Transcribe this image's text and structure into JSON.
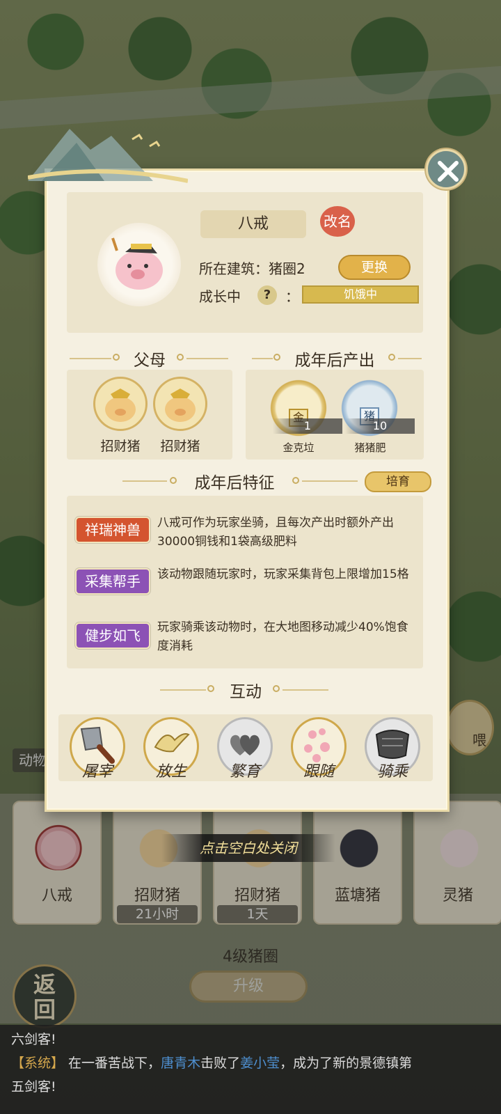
{
  "pet": {
    "name": "八戒",
    "rename_label": "改名",
    "location_label": "所在建筑：猪圈2",
    "change_label": "更换",
    "growth_label": "成长中",
    "help_symbol": "?",
    "colon": "：",
    "status": "饥饿中"
  },
  "sections": {
    "parents": "父母",
    "output": "成年后产出",
    "traits": "成年后特征",
    "interact": "互动"
  },
  "parents": [
    {
      "name": "招财猪"
    },
    {
      "name": "招财猪"
    }
  ],
  "outputs": [
    {
      "name": "金克垃",
      "icon_char": "金",
      "count": "1"
    },
    {
      "name": "猪猪肥",
      "icon_char": "猪",
      "count": "10"
    }
  ],
  "cultivate_label": "培育",
  "traits": [
    {
      "tag": "祥瑞神兽",
      "color": "#d4542f",
      "desc": "八戒可作为玩家坐骑，且每次产出时额外产出30000铜钱和1袋高级肥料"
    },
    {
      "tag": "采集帮手",
      "color": "#8c52b5",
      "desc": "该动物跟随玩家时，玩家采集背包上限增加15格"
    },
    {
      "tag": "健步如飞",
      "color": "#8c52b5",
      "desc": "玩家骑乘该动物时，在大地图移动减少40%饱食度消耗"
    }
  ],
  "actions": [
    {
      "label": "屠宰",
      "icon": "cleaver-icon"
    },
    {
      "label": "放生",
      "icon": "bird-icon"
    },
    {
      "label": "繁育",
      "icon": "hearts-icon"
    },
    {
      "label": "跟随",
      "icon": "pawprints-icon"
    },
    {
      "label": "骑乘",
      "icon": "saddle-icon"
    }
  ],
  "tap_close": "点击空白处关闭",
  "animals": [
    {
      "name": "八戒",
      "timer": ""
    },
    {
      "name": "招财猪",
      "timer": "21小时"
    },
    {
      "name": "招财猪",
      "timer": "1天"
    },
    {
      "name": "蓝塘猪",
      "timer": ""
    },
    {
      "name": "灵猪",
      "timer": ""
    }
  ],
  "pen_level": "4级猪圈",
  "upgrade_label": "升级",
  "back_label_1": "返",
  "back_label_2": "回",
  "left_label": "动物",
  "right_badge": "喂",
  "chat": {
    "line1": "六剑客!",
    "sys_tag": "【系统】",
    "pre": " 在一番苦战下，",
    "winner": "唐青木",
    "mid": "击败了",
    "loser": "姜小莹",
    "post": "，成为了新的景德镇第",
    "line3": "五剑客!"
  }
}
